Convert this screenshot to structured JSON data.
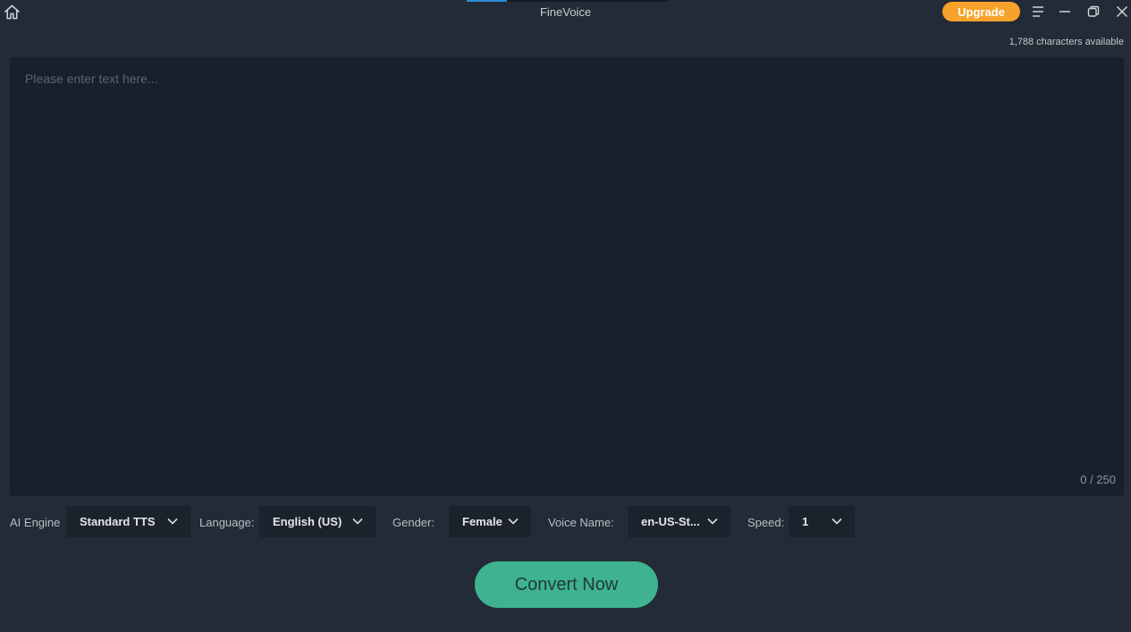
{
  "titlebar": {
    "app_title": "FineVoice",
    "upgrade_label": "Upgrade",
    "icons": {
      "home": "home-icon",
      "menu": "menu-icon",
      "minimize": "minimize-icon",
      "restore": "restore-icon",
      "close": "close-icon"
    }
  },
  "status": {
    "characters_available": "1,788 characters available"
  },
  "editor": {
    "placeholder": "Please enter text here...",
    "value": "",
    "char_count": "0 / 250"
  },
  "options": {
    "ai_engine": {
      "label": "AI Engine",
      "value": "Standard TTS"
    },
    "language": {
      "label": "Language:",
      "value": "English (US)"
    },
    "gender": {
      "label": "Gender:",
      "value": "Female"
    },
    "voice_name": {
      "label": "Voice Name:",
      "value": "en-US-St..."
    },
    "speed": {
      "label": "Speed:",
      "value": "1"
    }
  },
  "actions": {
    "convert_label": "Convert Now"
  },
  "colors": {
    "background": "#232b36",
    "editor_background": "#18202b",
    "accent_orange": "#f7a22a",
    "accent_green": "#3fb28f",
    "tab_active": "#2f8bd6"
  }
}
